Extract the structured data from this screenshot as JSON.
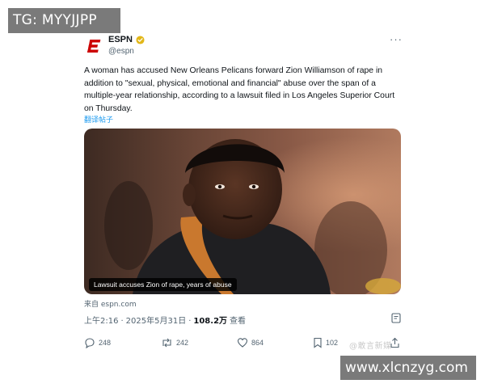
{
  "watermark_top": "TG: MYYJJPP",
  "watermark_bottom": "www.xlcnzyg.com",
  "watermark_mid": "@敢言新媒",
  "account": {
    "name": "ESPN",
    "handle": "@espn",
    "logo_icon": "espn-logo-icon",
    "verified_color": "#e2b719"
  },
  "tweet": {
    "text": "A woman has accused New Orleans Pelicans forward Zion Williamson of rape in addition to \"sexual, physical, emotional and financial\" abuse over the span of a multiple-year relationship, according to a lawsuit filed in Los Angeles Superior Court on Thursday.",
    "translate_label": "翻译帖子",
    "more_label": "···"
  },
  "media": {
    "caption": "Lawsuit accuses Zion of rape, years of abuse",
    "source": "来自 espn.com"
  },
  "meta": {
    "time": "上午2:16",
    "separator": "·",
    "date": "2025年5月31日",
    "views_count": "108.2万",
    "views_label": "查看"
  },
  "actions": {
    "replies": "248",
    "reposts": "242",
    "likes": "864",
    "bookmarks": "102"
  },
  "colors": {
    "text": "#0f1419",
    "secondary": "#536471",
    "link": "#1d9bf0",
    "brand_red": "#cc0000"
  }
}
